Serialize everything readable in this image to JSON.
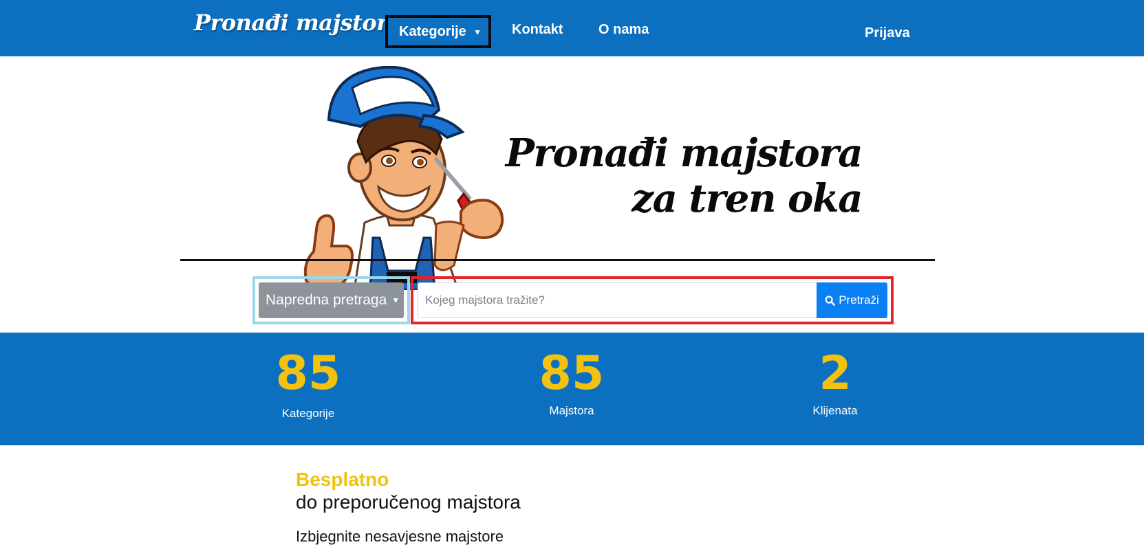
{
  "navbar": {
    "brand": "Pronađi majstora",
    "dropdown_label": "Kategorije",
    "links": [
      "Kontakt",
      "O nama"
    ],
    "login": "Prijava",
    "color": "#0d6fc0"
  },
  "hero": {
    "title_line1": "Pronađi majstora",
    "title_line2": "za tren oka",
    "mascot_icon": "handyman-mascot-icon"
  },
  "search": {
    "advanced_label": "Napredna pretraga",
    "placeholder": "Kojeg majstora tražite?",
    "value": "",
    "button_label": "Pretraži",
    "button_icon": "search-icon",
    "button_color": "#0b80f3"
  },
  "stats": [
    {
      "number": "85",
      "label": "Kategorije"
    },
    {
      "number": "85",
      "label": "Majstora"
    },
    {
      "number": "2",
      "label": "Klijenata"
    }
  ],
  "content": {
    "highlight": "Besplatno",
    "subtitle": "do preporučenog majstora",
    "text": "Izbjegnite nesavjesne majstore",
    "accent_color": "#f2c20e"
  }
}
